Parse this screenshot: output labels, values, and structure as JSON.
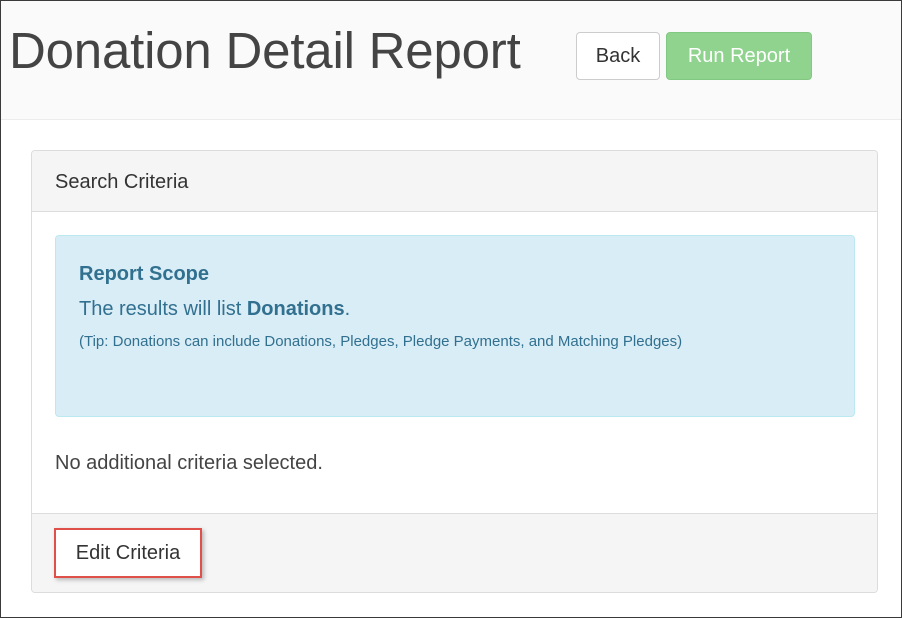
{
  "header": {
    "title": "Donation Detail Report",
    "back_label": "Back",
    "run_label": "Run Report"
  },
  "panel": {
    "heading": "Search Criteria",
    "scope": {
      "title": "Report Scope",
      "line_prefix": "The results will list ",
      "line_bold": "Donations",
      "line_suffix": ".",
      "tip": "(Tip: Donations can include Donations, Pledges, Pledge Payments, and Matching Pledges)"
    },
    "no_criteria_text": "No additional criteria selected.",
    "edit_label": "Edit Criteria"
  },
  "colors": {
    "run_button": "#8fd38f",
    "alert_bg": "#d9edf7",
    "alert_text": "#31708f",
    "highlight_border": "#e0504a"
  }
}
